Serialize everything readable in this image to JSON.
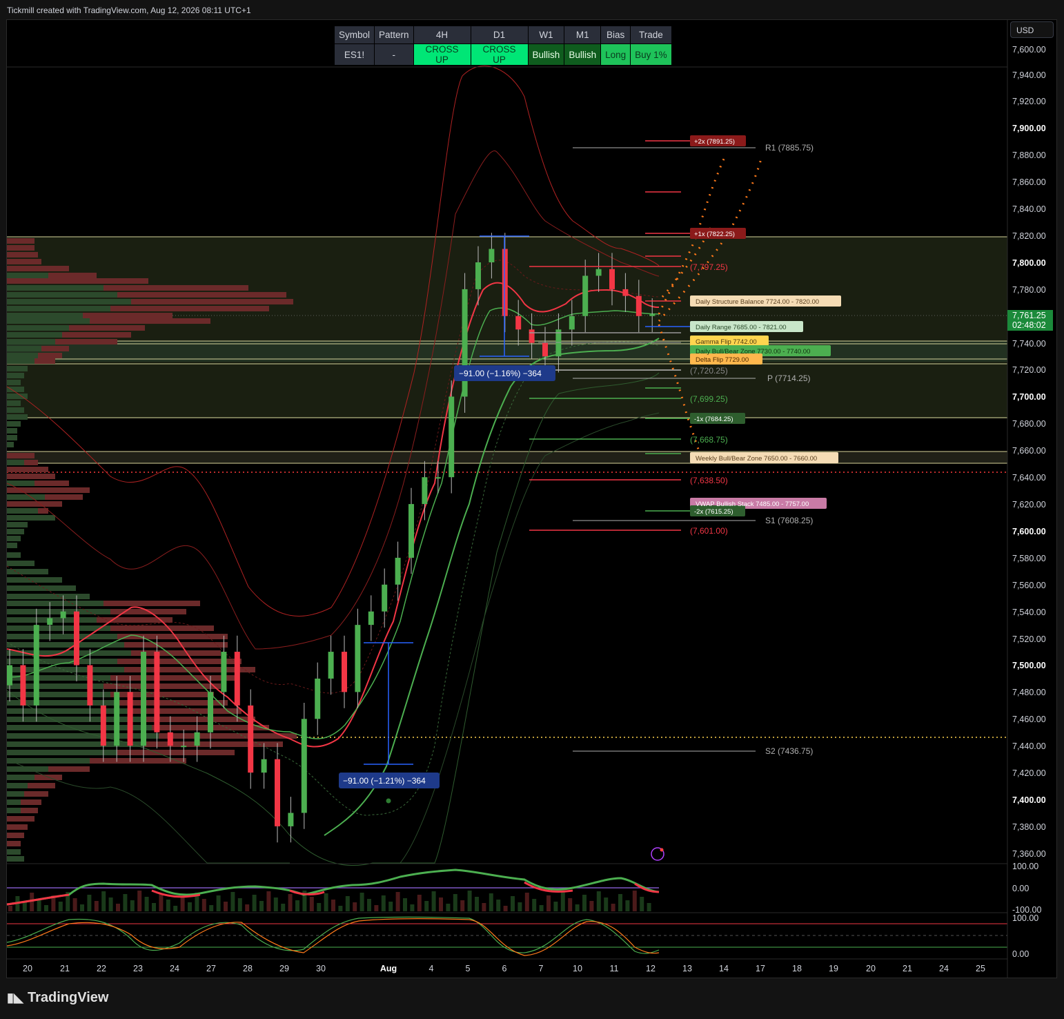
{
  "header": {
    "attribution": "Tickmill created with TradingView.com, Aug 12, 2026 08:11 UTC+1",
    "currency": "USD",
    "footer_logo": "TradingView"
  },
  "signal_table": {
    "headers": [
      "Symbol",
      "Pattern",
      "4H",
      "D1",
      "W1",
      "M1",
      "Bias",
      "Trade"
    ],
    "values": [
      "ES1!",
      "-",
      "CROSS UP",
      "CROSS UP",
      "Bullish",
      "Bullish",
      "Long",
      "Buy 1%"
    ]
  },
  "price_axis": {
    "labels": [
      "7,600.00",
      "7,940.00",
      "7,920.00",
      "7,900.00",
      "7,880.00",
      "7,860.00",
      "7,840.00",
      "7,820.00",
      "7,800.00",
      "7,780.00",
      "7,740.00",
      "7,720.00",
      "7,700.00",
      "7,680.00",
      "7,660.00",
      "7,640.00",
      "7,620.00",
      "7,600.00",
      "7,580.00",
      "7,560.00",
      "7,540.00",
      "7,520.00",
      "7,500.00",
      "7,480.00",
      "7,460.00",
      "7,440.00",
      "7,420.00",
      "7,400.00",
      "7,380.00",
      "7,360.00"
    ],
    "last_price": "7,761.25",
    "countdown": "02:48:02"
  },
  "time_axis": [
    "20",
    "21",
    "22",
    "23",
    "24",
    "27",
    "28",
    "29",
    "30",
    "Aug",
    "4",
    "5",
    "6",
    "7",
    "10",
    "11",
    "12",
    "13",
    "14",
    "17",
    "18",
    "19",
    "20",
    "21",
    "24",
    "25"
  ],
  "oscillator_axis": {
    "upper": [
      "100.00",
      "0.00",
      "-100.00"
    ],
    "lower": [
      "100.00",
      "0.00"
    ]
  },
  "annotations": {
    "targets": [
      "+2x (7891.25)",
      "+1x (7822.25)",
      "-1x (7684.25)",
      "-2x (7615.25)"
    ],
    "pivots": [
      "R1 (7885.75)",
      "P (7714.25)",
      "S1 (7608.25)",
      "S2 (7436.75)"
    ],
    "levels": [
      "(7,797.25)",
      "(7,720.25)",
      "(7,699.25)",
      "(7,668.75)",
      "(7,638.50)",
      "(7,601.00)"
    ],
    "zones": [
      "Daily Structure Balance  7724.00 - 7820.00",
      "Daily Range  7685.00 - 7821.00",
      "Gamma Flip  7742.00",
      "Daily Bull/Bear Zone  7730.00 - 7740.00",
      "Delta Flip  7729.00",
      "Weekly Bull/Bear Zone  7650.00 - 7660.00",
      "VWAP Bullish Stack  7485.00 - 7757.00"
    ],
    "measure_1": "−91.00 (−1.16%) −364",
    "measure_2": "−91.00 (−1.21%) −364"
  },
  "colors": {
    "bull": "#4caf50",
    "bear": "#f23645",
    "background": "#000000",
    "zone": "#2f3a1e",
    "projection": "#ff7a1a"
  },
  "chart_data": {
    "type": "candlestick",
    "title": "ES1!",
    "y_axis_range": [
      7345,
      7950
    ],
    "x_labels": [
      "20",
      "21",
      "22",
      "23",
      "24",
      "27",
      "28",
      "29",
      "30",
      "Aug",
      "4",
      "5",
      "6",
      "7",
      "10",
      "11",
      "12"
    ],
    "series": [
      {
        "name": "ES1!",
        "close": [
          7500,
          7470,
          7530,
          7535,
          7540,
          7500,
          7470,
          7440,
          7480,
          7440,
          7510,
          7450,
          7440,
          7440,
          7450,
          7480,
          7510,
          7470,
          7420,
          7430,
          7380,
          7390,
          7460,
          7490,
          7510,
          7480,
          7530,
          7540,
          7560,
          7580,
          7620,
          7640,
          7640,
          7700,
          7780,
          7800,
          7810,
          7760,
          7750,
          7740,
          7730,
          7750,
          7760,
          7790,
          7795,
          7780,
          7775,
          7760,
          7761.25
        ]
      }
    ],
    "last_price": 7761.25
  }
}
